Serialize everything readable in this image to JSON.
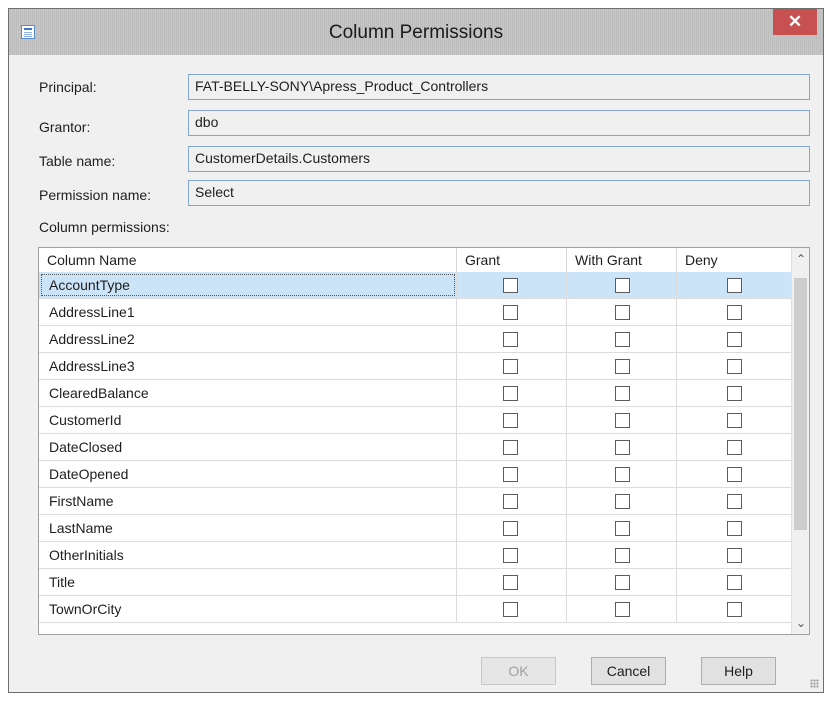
{
  "window": {
    "title": "Column Permissions",
    "close_label": "✕"
  },
  "fields": {
    "principal": {
      "label": "Principal:",
      "value": "FAT-BELLY-SONY\\Apress_Product_Controllers"
    },
    "grantor": {
      "label": "Grantor:",
      "value": "dbo"
    },
    "table_name": {
      "label": "Table name:",
      "value": "CustomerDetails.Customers"
    },
    "permission_name": {
      "label": "Permission name:",
      "value": "Select"
    }
  },
  "grid": {
    "section_label": "Column permissions:",
    "headers": {
      "name": "Column Name",
      "grant": "Grant",
      "with_grant": "With Grant",
      "deny": "Deny"
    },
    "rows": [
      {
        "name": "AccountType",
        "grant": false,
        "with_grant": false,
        "deny": false,
        "selected": true
      },
      {
        "name": "AddressLine1",
        "grant": false,
        "with_grant": false,
        "deny": false
      },
      {
        "name": "AddressLine2",
        "grant": false,
        "with_grant": false,
        "deny": false
      },
      {
        "name": "AddressLine3",
        "grant": false,
        "with_grant": false,
        "deny": false
      },
      {
        "name": "ClearedBalance",
        "grant": false,
        "with_grant": false,
        "deny": false
      },
      {
        "name": "CustomerId",
        "grant": false,
        "with_grant": false,
        "deny": false
      },
      {
        "name": "DateClosed",
        "grant": false,
        "with_grant": false,
        "deny": false
      },
      {
        "name": "DateOpened",
        "grant": false,
        "with_grant": false,
        "deny": false
      },
      {
        "name": "FirstName",
        "grant": false,
        "with_grant": false,
        "deny": false
      },
      {
        "name": "LastName",
        "grant": false,
        "with_grant": false,
        "deny": false
      },
      {
        "name": "OtherInitials",
        "grant": false,
        "with_grant": false,
        "deny": false
      },
      {
        "name": "Title",
        "grant": false,
        "with_grant": false,
        "deny": false
      },
      {
        "name": "TownOrCity",
        "grant": false,
        "with_grant": false,
        "deny": false
      }
    ]
  },
  "buttons": {
    "ok": "OK",
    "cancel": "Cancel",
    "help": "Help",
    "ok_enabled": false
  },
  "colors": {
    "selection": "#cce4f7",
    "close": "#c75050",
    "field_border": "#82a6cc"
  },
  "icons": {
    "window": "window-icon",
    "close": "close-icon",
    "scroll_up": "chevron-up-icon",
    "scroll_down": "chevron-down-icon"
  }
}
